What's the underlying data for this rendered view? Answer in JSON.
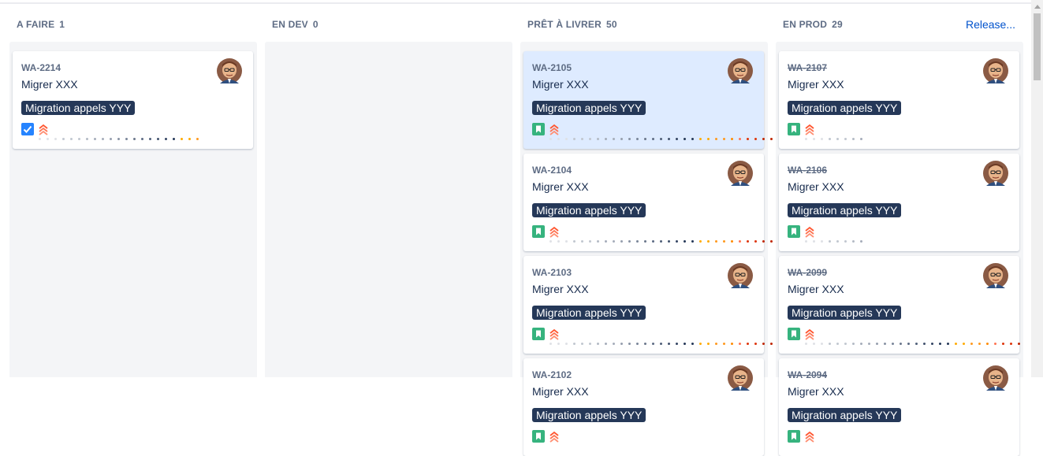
{
  "columns": [
    {
      "title": "A FAIRE",
      "count": "1",
      "cards": [
        {
          "key": "WA-2214",
          "summary": "Migrer XXX",
          "epic": "Migration appels YYY",
          "type_icon": "checkbox-icon",
          "priority_icon": "priority-highest-icon",
          "done": false,
          "selected": false,
          "dot_colors": [
            "#dfe1e6",
            "#dfe1e6",
            "#dfe1e6",
            "#c1c7d0",
            "#c1c7d0",
            "#c1c7d0",
            "#b3bac5",
            "#a5adba",
            "#a5adba",
            "#97a0af",
            "#8993a4",
            "#7a869a",
            "#6b778c",
            "#5e6c84",
            "#505f79",
            "#42526e",
            "#344563",
            "#253858",
            "#ffab00",
            "#ffab00",
            "#ff991f"
          ]
        }
      ]
    },
    {
      "title": "EN DEV",
      "count": "0",
      "cards": []
    },
    {
      "title": "PRÊT À LIVRER",
      "count": "50",
      "cards": [
        {
          "key": "WA-2105",
          "summary": "Migrer XXX",
          "epic": "Migration appels YYY",
          "type_icon": "story-bookmark-icon",
          "priority_icon": "priority-highest-icon",
          "done": false,
          "selected": true,
          "dot_colors": [
            "#dfe1e6",
            "#dfe1e6",
            "#dfe1e6",
            "#c1c7d0",
            "#c1c7d0",
            "#c1c7d0",
            "#b3bac5",
            "#a5adba",
            "#a5adba",
            "#97a0af",
            "#8993a4",
            "#7a869a",
            "#6b778c",
            "#5e6c84",
            "#505f79",
            "#42526e",
            "#344563",
            "#253858",
            "#253858",
            "#ffab00",
            "#ffab00",
            "#ff991f",
            "#ff991f",
            "#ff8b00",
            "#ff7452",
            "#de350b",
            "#de350b",
            "#bf2600",
            "#bf2600"
          ]
        },
        {
          "key": "WA-2104",
          "summary": "Migrer XXX",
          "epic": "Migration appels YYY",
          "type_icon": "story-bookmark-icon",
          "priority_icon": "priority-highest-icon",
          "done": false,
          "selected": false,
          "dot_colors": [
            "#dfe1e6",
            "#dfe1e6",
            "#dfe1e6",
            "#c1c7d0",
            "#c1c7d0",
            "#c1c7d0",
            "#b3bac5",
            "#a5adba",
            "#a5adba",
            "#97a0af",
            "#8993a4",
            "#7a869a",
            "#6b778c",
            "#5e6c84",
            "#505f79",
            "#42526e",
            "#344563",
            "#253858",
            "#253858",
            "#ffab00",
            "#ffab00",
            "#ff991f",
            "#ff991f",
            "#ff8b00",
            "#ff7452",
            "#de350b",
            "#de350b",
            "#bf2600",
            "#bf2600"
          ]
        },
        {
          "key": "WA-2103",
          "summary": "Migrer XXX",
          "epic": "Migration appels YYY",
          "type_icon": "story-bookmark-icon",
          "priority_icon": "priority-highest-icon",
          "done": false,
          "selected": false,
          "dot_colors": [
            "#dfe1e6",
            "#dfe1e6",
            "#dfe1e6",
            "#c1c7d0",
            "#c1c7d0",
            "#c1c7d0",
            "#b3bac5",
            "#a5adba",
            "#a5adba",
            "#97a0af",
            "#8993a4",
            "#7a869a",
            "#6b778c",
            "#5e6c84",
            "#505f79",
            "#42526e",
            "#344563",
            "#253858",
            "#253858",
            "#ffab00",
            "#ffab00",
            "#ff991f",
            "#ff991f",
            "#ff8b00",
            "#ff7452",
            "#de350b",
            "#de350b",
            "#bf2600",
            "#bf2600"
          ]
        },
        {
          "key": "WA-2102",
          "summary": "Migrer XXX",
          "epic": "Migration appels YYY",
          "type_icon": "story-bookmark-icon",
          "priority_icon": "priority-highest-icon",
          "done": false,
          "selected": false,
          "dot_colors": []
        }
      ]
    },
    {
      "title": "EN PROD",
      "count": "29",
      "release_label": "Release...",
      "cards": [
        {
          "key": "WA-2107",
          "summary": "Migrer XXX",
          "epic": "Migration appels YYY",
          "type_icon": "story-bookmark-icon",
          "priority_icon": "priority-highest-icon",
          "done": true,
          "selected": false,
          "dot_colors": [
            "#dfe1e6",
            "#dfe1e6",
            "#dfe1e6",
            "#c1c7d0",
            "#c1c7d0",
            "#c1c7d0",
            "#b3bac5",
            "#a5adba"
          ]
        },
        {
          "key": "WA-2106",
          "summary": "Migrer XXX",
          "epic": "Migration appels YYY",
          "type_icon": "story-bookmark-icon",
          "priority_icon": "priority-highest-icon",
          "done": true,
          "selected": false,
          "dot_colors": [
            "#dfe1e6",
            "#dfe1e6",
            "#dfe1e6",
            "#c1c7d0",
            "#c1c7d0",
            "#c1c7d0",
            "#b3bac5",
            "#a5adba"
          ]
        },
        {
          "key": "WA-2099",
          "summary": "Migrer XXX",
          "epic": "Migration appels YYY",
          "type_icon": "story-bookmark-icon",
          "priority_icon": "priority-highest-icon",
          "done": true,
          "selected": false,
          "dot_colors": [
            "#dfe1e6",
            "#dfe1e6",
            "#dfe1e6",
            "#c1c7d0",
            "#c1c7d0",
            "#c1c7d0",
            "#b3bac5",
            "#a5adba",
            "#a5adba",
            "#97a0af",
            "#8993a4",
            "#7a869a",
            "#6b778c",
            "#5e6c84",
            "#505f79",
            "#42526e",
            "#344563",
            "#253858",
            "#253858",
            "#ffab00",
            "#ffab00",
            "#ff991f",
            "#ff991f",
            "#ff8b00",
            "#ff7452",
            "#de350b",
            "#de350b",
            "#bf2600"
          ]
        },
        {
          "key": "WA-2094",
          "summary": "Migrer XXX",
          "epic": "Migration appels YYY",
          "type_icon": "story-bookmark-icon",
          "priority_icon": "priority-highest-icon",
          "done": true,
          "selected": false,
          "dot_colors": []
        }
      ]
    }
  ],
  "colors": {
    "epic_bg": "#253858",
    "story_green": "#36b37e",
    "task_blue": "#2684ff",
    "priority_red": "#ff5630",
    "selected_card": "#deebff",
    "link_blue": "#0052cc"
  }
}
